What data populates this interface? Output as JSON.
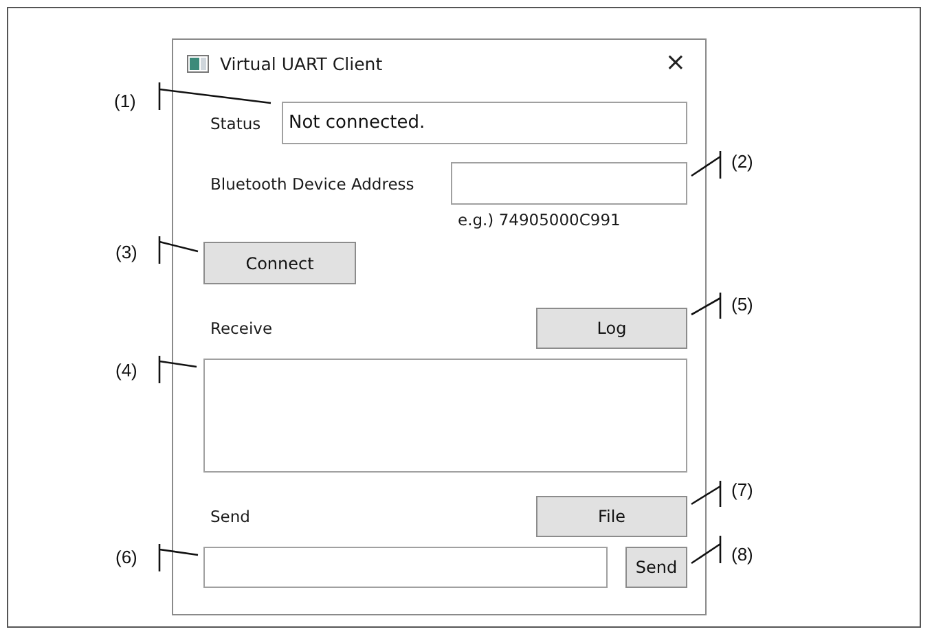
{
  "window": {
    "title": "Virtual UART Client",
    "close": "×"
  },
  "status": {
    "label": "Status",
    "value": "Not connected."
  },
  "address": {
    "label": "Bluetooth Device Address",
    "hint": "e.g.) 74905000C991"
  },
  "connect_button": "Connect",
  "receive": {
    "label": "Receive",
    "log_button": "Log"
  },
  "send": {
    "label": "Send",
    "file_button": "File",
    "send_button": "Send"
  },
  "callouts": [
    {
      "label": "(1)"
    },
    {
      "label": "(2)"
    },
    {
      "label": "(3)"
    },
    {
      "label": "(5)"
    },
    {
      "label": "(4)"
    },
    {
      "label": "(7)"
    },
    {
      "label": "(6)"
    },
    {
      "label": "(8)"
    }
  ]
}
